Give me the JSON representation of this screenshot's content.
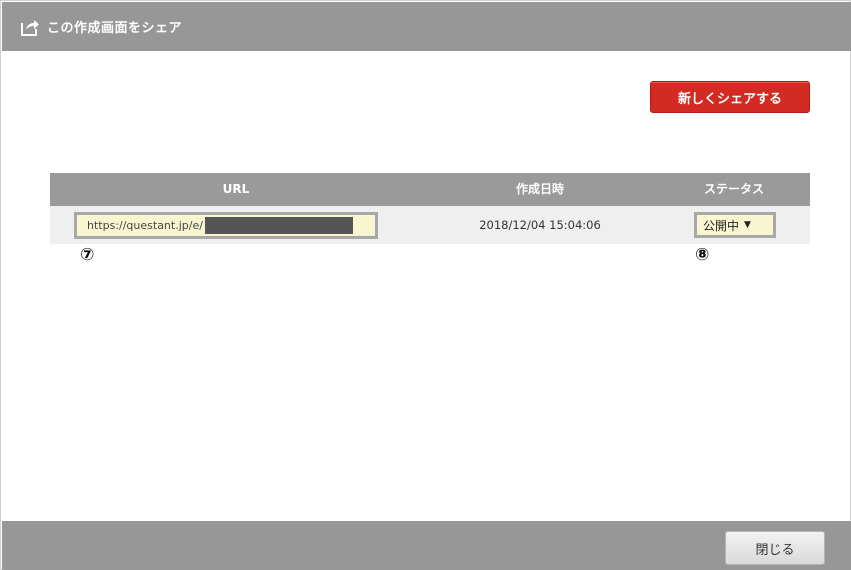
{
  "header": {
    "title": "この作成画面をシェア",
    "icon": "share-icon"
  },
  "toolbar": {
    "new_share_label": "新しくシェアする"
  },
  "table": {
    "columns": [
      "URL",
      "作成日時",
      "ステータス"
    ],
    "rows": [
      {
        "url_prefix": "https://questant.jp/e/",
        "created_at": "2018/12/04 15:04:06",
        "status": "公開中"
      }
    ]
  },
  "annotations": {
    "marker_url": "⑦",
    "marker_status": "⑧"
  },
  "footer": {
    "close_label": "閉じる"
  },
  "colors": {
    "header_bg": "#979797",
    "accent_red": "#d42a24",
    "field_bg": "#f8f6d0"
  }
}
